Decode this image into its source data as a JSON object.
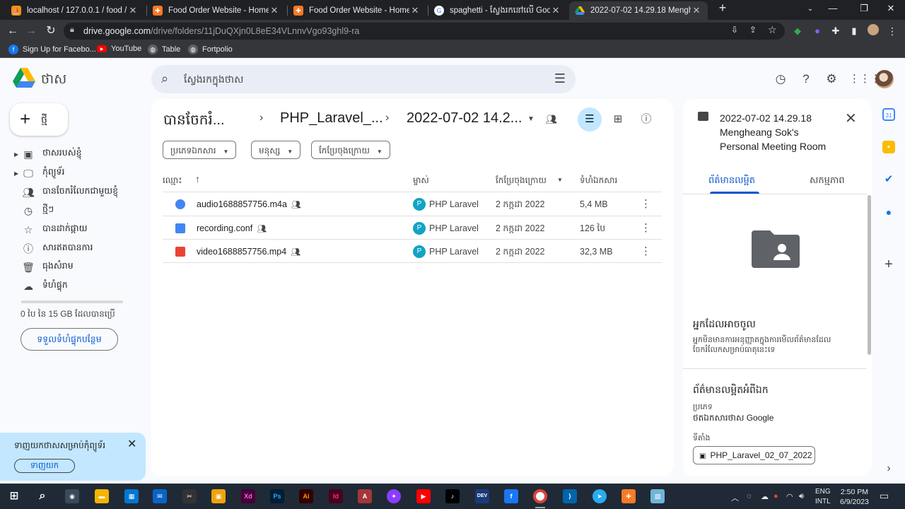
{
  "browser": {
    "tabs": [
      {
        "title": "localhost / 127.0.0.1 / food / foo",
        "icon": "phpmyadmin-icon"
      },
      {
        "title": "Food Order Website - Home pag",
        "icon": "xampp-icon"
      },
      {
        "title": "Food Order Website - Home pag",
        "icon": "xampp-icon"
      },
      {
        "title": "spaghetti - ស្វែងរកនៅលើ Google",
        "icon": "google-icon"
      },
      {
        "title": "2022-07-02 14.29.18 Mengheang",
        "icon": "google-drive-icon"
      }
    ],
    "url_host": "drive.google.com",
    "url_path": "/drive/folders/11jDuQXjn0L8eE34VLnnvVgo93ghl9-ra",
    "bookmarks": [
      "Sign Up for Facebo...",
      "YouTube",
      "Table",
      "Fortpolio"
    ]
  },
  "drive": {
    "app_title": "ថាស",
    "search_placeholder": "ស្វែងរកក្នុងថាស",
    "new_button": "ថ្មី",
    "nav": [
      {
        "label": "ថាសរបស់ខ្ញុំ",
        "icon": "my-drive-icon"
      },
      {
        "label": "កុំព្យូទ័រ",
        "icon": "computer-icon"
      },
      {
        "label": "បានចែករំលែកជាមួយខ្ញុំ",
        "icon": "shared-icon"
      },
      {
        "label": "ថ្មីៗ",
        "icon": "clock-icon"
      },
      {
        "label": "បានដាក់ផ្កាយ",
        "icon": "star-icon"
      },
      {
        "label": "សារឥតបានការ",
        "icon": "spam-icon"
      },
      {
        "label": "ធុងសំរាម",
        "icon": "trash-icon"
      },
      {
        "label": "ទំហំផ្ទុក",
        "icon": "cloud-icon"
      }
    ],
    "storage_text": "0 បៃ នៃ 15 GB ដែលបានប្រើ",
    "get_storage": "ទទួលទំហំផ្ទុកបន្ថែម",
    "download_banner": {
      "text": "ទាញយកថាសសម្រាប់កុំព្យូទ័រ",
      "button": "ទាញយក"
    },
    "breadcrumbs": [
      "បានចែករំ...",
      "PHP_Laravel_...",
      "2022-07-02 14.2..."
    ],
    "filters": [
      "ប្រភេទឯកសារ",
      "មនុស្ស",
      "កែប្រែចុងក្រោយ"
    ],
    "columns": {
      "name": "ឈ្មោះ",
      "owner": "ម្ចាស់",
      "modified": "កែប្រែចុងក្រោយ",
      "size": "ទំហំឯកសារ"
    },
    "files": [
      {
        "name": "audio1688857756.m4a",
        "type": "audio",
        "owner": "PHP Laravel",
        "owner_initial": "P",
        "modified": "2 កក្កដា 2022",
        "size": "5,4 MB"
      },
      {
        "name": "recording.conf",
        "type": "doc",
        "owner": "PHP Laravel",
        "owner_initial": "P",
        "modified": "2 កក្កដា 2022",
        "size": "126 បៃ"
      },
      {
        "name": "video1688857756.mp4",
        "type": "video",
        "owner": "PHP Laravel",
        "owner_initial": "P",
        "modified": "2 កក្កដា 2022",
        "size": "32,3 MB"
      }
    ],
    "details": {
      "title": "2022-07-02 14.29.18 Mengheang Sok's Personal Meeting Room",
      "tab_details": "ព័ត៌មានលម្អិត",
      "tab_activity": "សកម្មភាព",
      "access_heading": "អ្នកដែលអាចចូល",
      "access_text": "អ្នកមិនមានការអនុញ្ញាតក្នុងការមើលព័ត៌មានដែលចែករំលែកសម្រាប់ធាតុនេះទេ",
      "info_heading": "ព័ត៌មានលម្អិតអំពីឯក",
      "type_label": "ប្រភេទ",
      "type_value": "ថតឯកសារថាស Google",
      "location_label": "ទីតាំង",
      "location_value": "PHP_Laravel_02_07_2022"
    }
  },
  "taskbar": {
    "apps": [
      "Ps",
      "Ai",
      "Id",
      "Xd"
    ],
    "lang_top": "ENG",
    "lang_bottom": "INTL",
    "time": "2:50 PM",
    "date": "6/9/2023"
  },
  "colors": {
    "accent": "#0b57d0",
    "selected": "#c2e7ff",
    "owner_avatar": "#12a3c4"
  }
}
